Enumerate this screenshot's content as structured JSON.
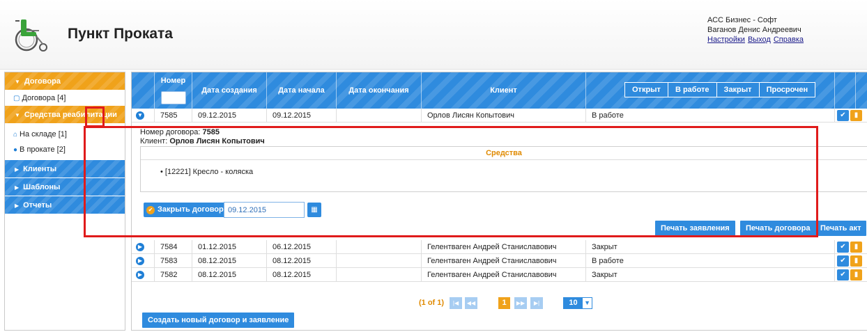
{
  "header": {
    "title": "Пункт Проката",
    "company": "АСС Бизнес - Софт",
    "user": "Ваганов Денис Андреевич",
    "links": [
      "Настройки",
      "Выход",
      "Справка"
    ]
  },
  "sidebar": {
    "contracts": {
      "label": "Договора",
      "items": [
        {
          "label": "Договора [4]",
          "icon": "document-icon"
        }
      ]
    },
    "rehab": {
      "label": "Средства реабилитации",
      "items": [
        {
          "label": "На складе [1]",
          "icon": "home-icon"
        },
        {
          "label": "В прокате [2]",
          "icon": "circle-icon"
        }
      ]
    },
    "clients": {
      "label": "Клиенты"
    },
    "templates": {
      "label": "Шаблоны"
    },
    "reports": {
      "label": "Отчеты"
    }
  },
  "table": {
    "columns": {
      "number": "Номер",
      "created": "Дата создания",
      "start": "Дата начала",
      "end": "Дата окончания",
      "client": "Клиент"
    },
    "status_filters": [
      "Открыт",
      "В работе",
      "Закрыт",
      "Просрочен"
    ],
    "rows": [
      {
        "number": "7585",
        "created": "09.12.2015",
        "start": "09.12.2015",
        "end": "",
        "client": "Орлов Лисян Копытович",
        "status": "В работе"
      },
      {
        "number": "7584",
        "created": "01.12.2015",
        "start": "06.12.2015",
        "end": "",
        "client": "Гелентваген Андрей Станиславович",
        "status": "Закрыт"
      },
      {
        "number": "7583",
        "created": "08.12.2015",
        "start": "08.12.2015",
        "end": "",
        "client": "Гелентваген Андрей Станиславович",
        "status": "В работе"
      },
      {
        "number": "7582",
        "created": "08.12.2015",
        "start": "08.12.2015",
        "end": "",
        "client": "Гелентваген Андрей Станиславович",
        "status": "Закрыт"
      }
    ]
  },
  "detail": {
    "contract_label": "Номер договора:",
    "contract_number": "7585",
    "client_label": "Клиент:",
    "client_name": "Орлов Лисян Копытович",
    "items_header": "Средства",
    "items": [
      "[12221] Кресло - коляска"
    ],
    "close_button": "Закрыть договор",
    "close_date": "09.12.2015",
    "print_application": "Печать заявления",
    "print_contract": "Печать договора",
    "print_act": "Печать акт"
  },
  "pager": {
    "text": "(1 of 1)",
    "current": "1",
    "page_size": "10"
  },
  "create_button": "Создать новый договор и заявление",
  "colors": {
    "accent_blue": "#2f8bde",
    "accent_orange": "#f0a21a",
    "annotation_red": "#e01b1b"
  }
}
